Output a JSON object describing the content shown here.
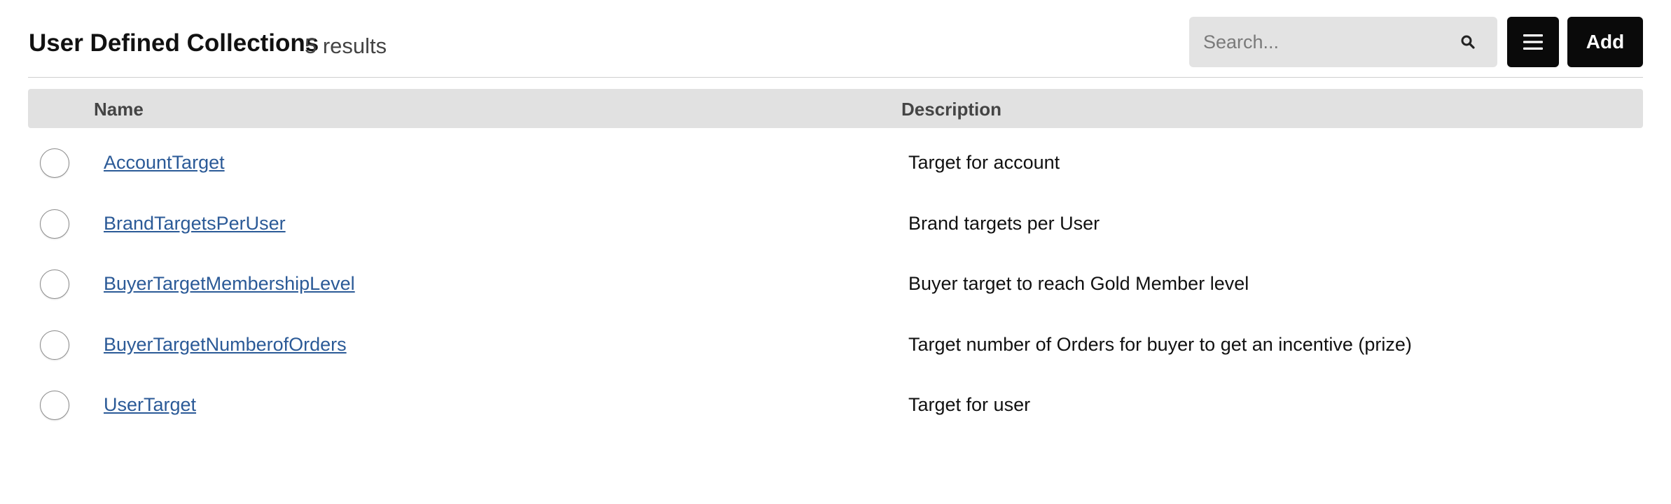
{
  "header": {
    "title": "User Defined Collections",
    "result_count": "5 results"
  },
  "search": {
    "placeholder": "Search...",
    "value": "",
    "icon": "search-icon"
  },
  "toolbar": {
    "menu_icon": "hamburger-menu-icon",
    "add_label": "Add"
  },
  "table": {
    "columns": [
      "Name",
      "Description"
    ],
    "rows": [
      {
        "name": "AccountTarget",
        "description": "Target for account"
      },
      {
        "name": "BrandTargetsPerUser",
        "description": "Brand targets per User"
      },
      {
        "name": "BuyerTargetMembershipLevel",
        "description": "Buyer target to reach Gold Member level"
      },
      {
        "name": "BuyerTargetNumberofOrders",
        "description": "Target number of Orders for buyer to get an incentive (prize)"
      },
      {
        "name": "UserTarget",
        "description": "Target for user"
      }
    ]
  },
  "colors": {
    "link": "#2b5a97",
    "button_bg": "#0a0a0a",
    "header_bg": "#e1e1e1",
    "search_bg": "#e3e3e3"
  }
}
